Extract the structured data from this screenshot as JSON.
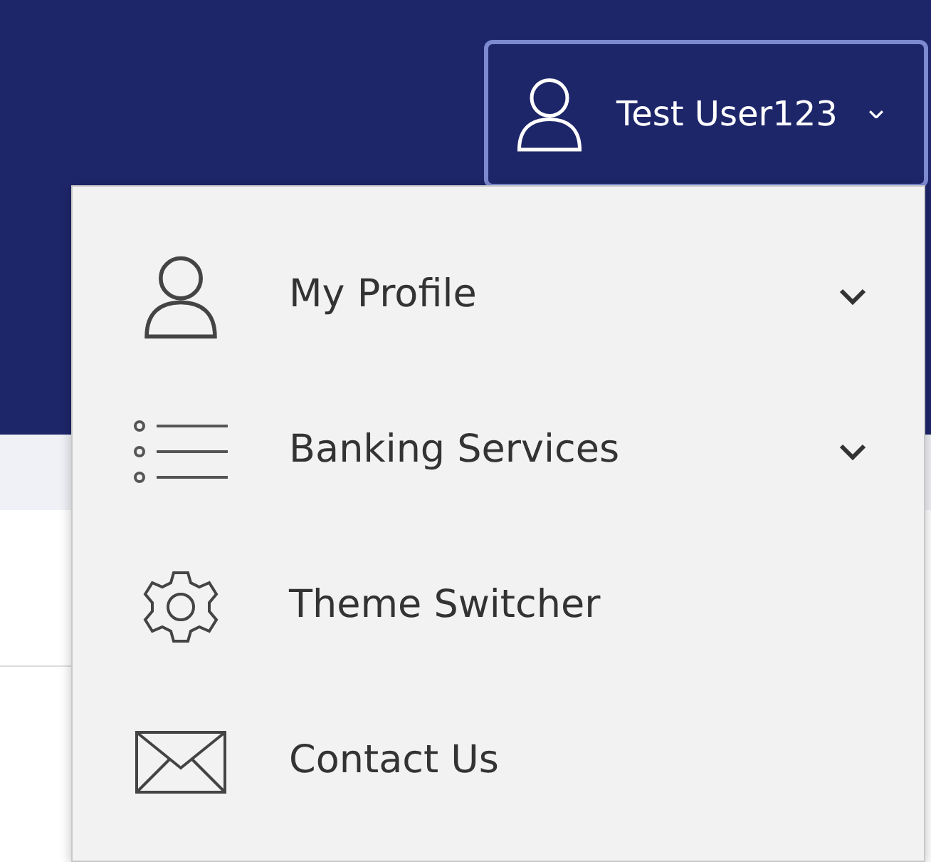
{
  "user_menu": {
    "name": "Test User123",
    "expanded": true
  },
  "menu_items": [
    {
      "label": "My Profile",
      "expandable": true
    },
    {
      "label": "Banking Services",
      "expandable": true
    },
    {
      "label": "Theme Switcher",
      "expandable": false
    },
    {
      "label": "Contact Us",
      "expandable": false
    }
  ]
}
